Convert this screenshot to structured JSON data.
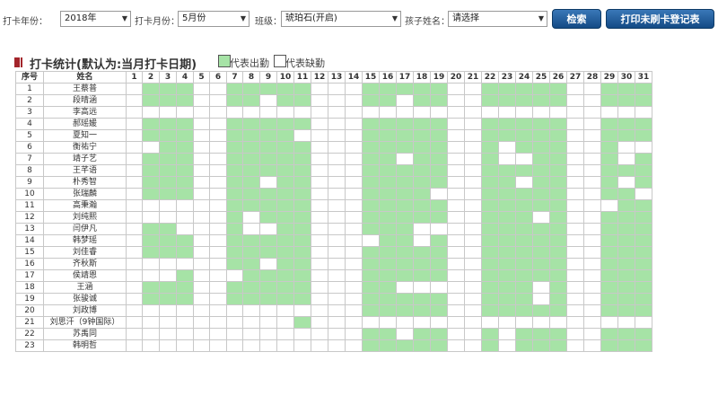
{
  "filters": {
    "year_label": "打卡年份：",
    "year_value": "2018年",
    "month_label": "打卡月份：",
    "month_value": "5月份",
    "class_label": "班级：",
    "class_value": "琥珀石(开启)",
    "child_label": "孩子姓名：",
    "child_value": "请选择",
    "search_button": "检索",
    "print_button": "打印未刷卡登记表"
  },
  "section": {
    "title": "打卡统计(默认为:当月打卡日期)",
    "legend_present": "代表出勤",
    "legend_absent": "代表缺勤"
  },
  "colors": {
    "present": "#a6e3a6",
    "absent": "#ffffff",
    "button": "#1f5a96",
    "marker": "#a3252b"
  },
  "table": {
    "col_index": "序号",
    "col_name": "姓名",
    "days": [
      "1",
      "2",
      "3",
      "4",
      "5",
      "6",
      "7",
      "8",
      "9",
      "10",
      "11",
      "12",
      "13",
      "14",
      "15",
      "16",
      "17",
      "18",
      "19",
      "20",
      "21",
      "22",
      "23",
      "24",
      "25",
      "26",
      "27",
      "28",
      "29",
      "30",
      "31"
    ],
    "rows": [
      {
        "no": "1",
        "name": "王蔡普",
        "att": "0111001111100011111001111100111"
      },
      {
        "no": "2",
        "name": "段晴涵",
        "att": "0111001101100011011001111100111"
      },
      {
        "no": "3",
        "name": "李高远",
        "att": "0000000000000000000000000000000"
      },
      {
        "no": "4",
        "name": "郝瑶媛",
        "att": "0111001111100011111001111100111"
      },
      {
        "no": "5",
        "name": "夏知一",
        "att": "0111001111000011111001111100111"
      },
      {
        "no": "6",
        "name": "衡祐宁",
        "att": "0011001111100011111001011100100"
      },
      {
        "no": "7",
        "name": "靖子艺",
        "att": "0111001111100011011001001100101"
      },
      {
        "no": "8",
        "name": "王芊语",
        "att": "0111001111100011111001111100111"
      },
      {
        "no": "9",
        "name": "朴秀智",
        "att": "0111001101100011111001101100101"
      },
      {
        "no": "10",
        "name": "张瑞麟",
        "att": "0111001111100011110001111100110"
      },
      {
        "no": "11",
        "name": "高秉瀚",
        "att": "0000001111100011111001111100011"
      },
      {
        "no": "12",
        "name": "刘纯熙",
        "att": "0000001011100011111001110100111"
      },
      {
        "no": "13",
        "name": "闫伊凡",
        "att": "0110001001100011100001111100111"
      },
      {
        "no": "14",
        "name": "韩梦瑶",
        "att": "0111001111100001101001111100111"
      },
      {
        "no": "15",
        "name": "刘佳睿",
        "att": "0111001111100011111001111100111"
      },
      {
        "no": "16",
        "name": "齐秋斯",
        "att": "0000001101100011111001111100111"
      },
      {
        "no": "17",
        "name": "侯靖恩",
        "att": "0001000111100011111001111100111"
      },
      {
        "no": "18",
        "name": "王涵",
        "att": "0111001111100011000001110100111"
      },
      {
        "no": "19",
        "name": "张骏诚",
        "att": "0111001111100011111001110100111"
      },
      {
        "no": "20",
        "name": "刘政博",
        "att": "0000000000000011111001111100111"
      },
      {
        "no": "21",
        "name": "刘思汗（9钟国际）",
        "att": "0000000000100000000000000000000"
      },
      {
        "no": "22",
        "name": "苏禹同",
        "att": "0000000000000011011001011100111"
      },
      {
        "no": "23",
        "name": "韩明哲",
        "att": "0000000000000011111001011100111"
      }
    ]
  }
}
